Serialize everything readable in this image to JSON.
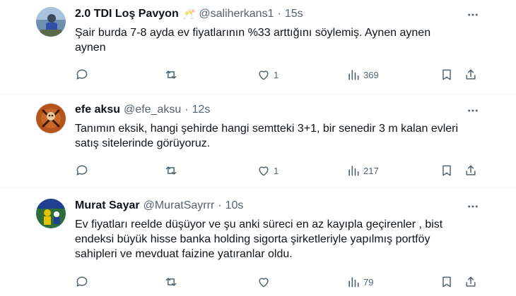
{
  "tweets": [
    {
      "display_name": "2.0 TDI Loş Pavyon",
      "emoji": "🥂",
      "handle": "@saliherkans1",
      "separator": "·",
      "time": "15s",
      "text_lines": [
        "Şair burda 7-8 ayda ev fiyatlarının %33 arttığını söylemiş. Aynen aynen",
        "aynen"
      ],
      "replies": "",
      "retweets": "",
      "likes": "1",
      "views": "369",
      "icons": [
        "reply-icon",
        "retweet-icon",
        "like-icon",
        "views-icon",
        "bookmark-icon",
        "share-icon",
        "more-icon"
      ]
    },
    {
      "display_name": "efe aksu",
      "emoji": "",
      "handle": "@efe_aksu",
      "separator": "·",
      "time": "12s",
      "text_lines": [
        "Tanımın eksik, hangi şehirde hangi semtteki 3+1, bir senedir 3 m kalan evleri",
        "satış sitelerinde görüyoruz."
      ],
      "replies": "",
      "retweets": "",
      "likes": "1",
      "views": "217",
      "icons": [
        "reply-icon",
        "retweet-icon",
        "like-icon",
        "views-icon",
        "bookmark-icon",
        "share-icon",
        "more-icon"
      ]
    },
    {
      "display_name": "Murat Sayar",
      "emoji": "",
      "handle": "@MuratSayrrr",
      "separator": "·",
      "time": "10s",
      "text_lines": [
        "Ev fiyatları reelde düşüyor ve şu anki süreci en az kayıpla geçirenler , bist",
        "endeksi büyük hisse banka holding sigorta şirketleriyle yapılmış portföy",
        "sahipleri ve mevduat faizine yatıranlar oldu."
      ],
      "replies": "",
      "retweets": "",
      "likes": "",
      "views": "79",
      "icons": [
        "reply-icon",
        "retweet-icon",
        "like-icon",
        "views-icon",
        "bookmark-icon",
        "share-icon",
        "more-icon"
      ]
    }
  ],
  "colors": {
    "text": "#0f1419",
    "secondary": "#536471",
    "divider": "#eff3f4"
  }
}
